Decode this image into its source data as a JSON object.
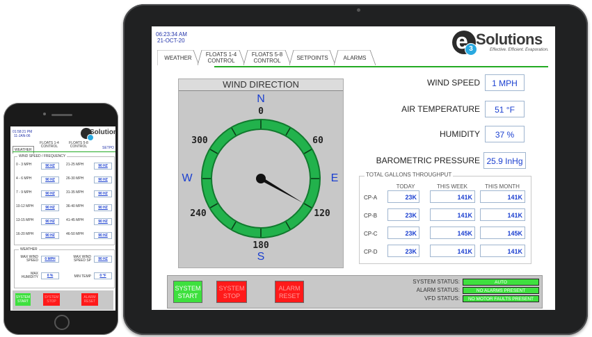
{
  "tablet": {
    "time": "06:23:34 AM",
    "date": "21-OCT-20",
    "logo": {
      "brand": "Solutions",
      "tagline": "Effective. Efficient. Evaporation.",
      "letter": "e",
      "sub": "3"
    },
    "tabs": [
      {
        "l1": "WEATHER",
        "l2": ""
      },
      {
        "l1": "FLOATS 1-4",
        "l2": "CONTROL"
      },
      {
        "l1": "FLOATS 5-8",
        "l2": "CONTROL"
      },
      {
        "l1": "SETPOINTS",
        "l2": ""
      },
      {
        "l1": "ALARMS",
        "l2": ""
      }
    ],
    "wind_direction": {
      "title": "WIND DIRECTION",
      "n": "N",
      "s": "S",
      "e": "E",
      "w": "W",
      "deg0": "0",
      "deg60": "60",
      "deg120": "120",
      "deg180": "180",
      "deg240": "240",
      "deg300": "300",
      "needle_deg": 120,
      "colors": {
        "ring": "#22b24c",
        "ring_dark": "#117a2e"
      }
    },
    "readouts": [
      {
        "label": "WIND SPEED",
        "value": "1 MPH"
      },
      {
        "label": "AIR TEMPERATURE",
        "value": "51 °F"
      },
      {
        "label": "HUMIDITY",
        "value": "37 %"
      },
      {
        "label": "BAROMETRIC PRESSURE",
        "value": "25.9 InHg"
      }
    ],
    "gallons": {
      "title": "TOTAL GALLONS THROUGHPUT",
      "headers": [
        "TODAY",
        "THIS WEEK",
        "THIS MONTH"
      ],
      "rows": [
        {
          "label": "CP-A",
          "values": [
            "23K",
            "141K",
            "141K"
          ]
        },
        {
          "label": "CP-B",
          "values": [
            "23K",
            "141K",
            "141K"
          ]
        },
        {
          "label": "CP-C",
          "values": [
            "23K",
            "145K",
            "145K"
          ]
        },
        {
          "label": "CP-D",
          "values": [
            "23K",
            "141K",
            "141K"
          ]
        }
      ]
    },
    "buttons": {
      "start": {
        "l1": "SYSTEM",
        "l2": "START",
        "color": "#3ee03e"
      },
      "stop": {
        "l1": "SYSTEM",
        "l2": "STOP",
        "color": "#ff1a1a"
      },
      "reset": {
        "l1": "ALARM",
        "l2": "RESET",
        "color": "#ff1a1a"
      }
    },
    "status": [
      {
        "label": "SYSTEM STATUS:",
        "value": "AUTO"
      },
      {
        "label": "ALARM STATUS:",
        "value": "NO ALARMS PRESENT"
      },
      {
        "label": "VFD STATUS:",
        "value": "NO MOTOR FAULTS PRESENT"
      }
    ]
  },
  "phone": {
    "time": "01:58:21 PM",
    "date": "11-JAN-06",
    "brand": "Solutions",
    "tabs": [
      "WEATHER",
      "FLOATS 1-4 CONTROL",
      "FLOATS 5-8 CONTROL",
      "SETPO"
    ],
    "freq_title": "WIND SPEED / FREQUENCY",
    "freq_rows": [
      {
        "l1": "0 - 3 MPH",
        "v1": "90 HZ",
        "l2": "21-25 MPH",
        "v2": "90 HZ"
      },
      {
        "l1": "4 - 6 MPH",
        "v1": "90 HZ",
        "l2": "26-30 MPH",
        "v2": "90 HZ"
      },
      {
        "l1": "7 - 9 MPH",
        "v1": "90 HZ",
        "l2": "31-35 MPH",
        "v2": "90 HZ"
      },
      {
        "l1": "10-12 MPH",
        "v1": "90 HZ",
        "l2": "36-40 MPH",
        "v2": "90 HZ"
      },
      {
        "l1": "13-15 MPH",
        "v1": "90 HZ",
        "l2": "41-45 MPH",
        "v2": "90 HZ"
      },
      {
        "l1": "16-20 MPH",
        "v1": "90 HZ",
        "l2": "46-50 MPH",
        "v2": "90 HZ"
      }
    ],
    "weather_title": "WEATHER",
    "weather": {
      "max_wind_speed_l1": "MAX WIND",
      "max_wind_speed_l2": "SPEED",
      "max_wind_speed": "0 MPH",
      "max_wind_sp_l1": "MAX WIND",
      "max_wind_sp_l2": "SPEED SP",
      "max_wind_sp": "90 HZ",
      "max_humidity_l1": "MAX",
      "max_humidity_l2": "HUMIDITY",
      "max_humidity": "0 %",
      "min_temp_label": "MIN TEMP",
      "min_temp": "0 °F"
    },
    "buttons": [
      {
        "l1": "SYSTEM",
        "l2": "START",
        "color": "#3ee03e"
      },
      {
        "l1": "SYSTEM",
        "l2": "STOP",
        "color": "#ff1a1a"
      },
      {
        "l1": "ALARM",
        "l2": "RESET",
        "color": "#ff1a1a"
      }
    ]
  }
}
